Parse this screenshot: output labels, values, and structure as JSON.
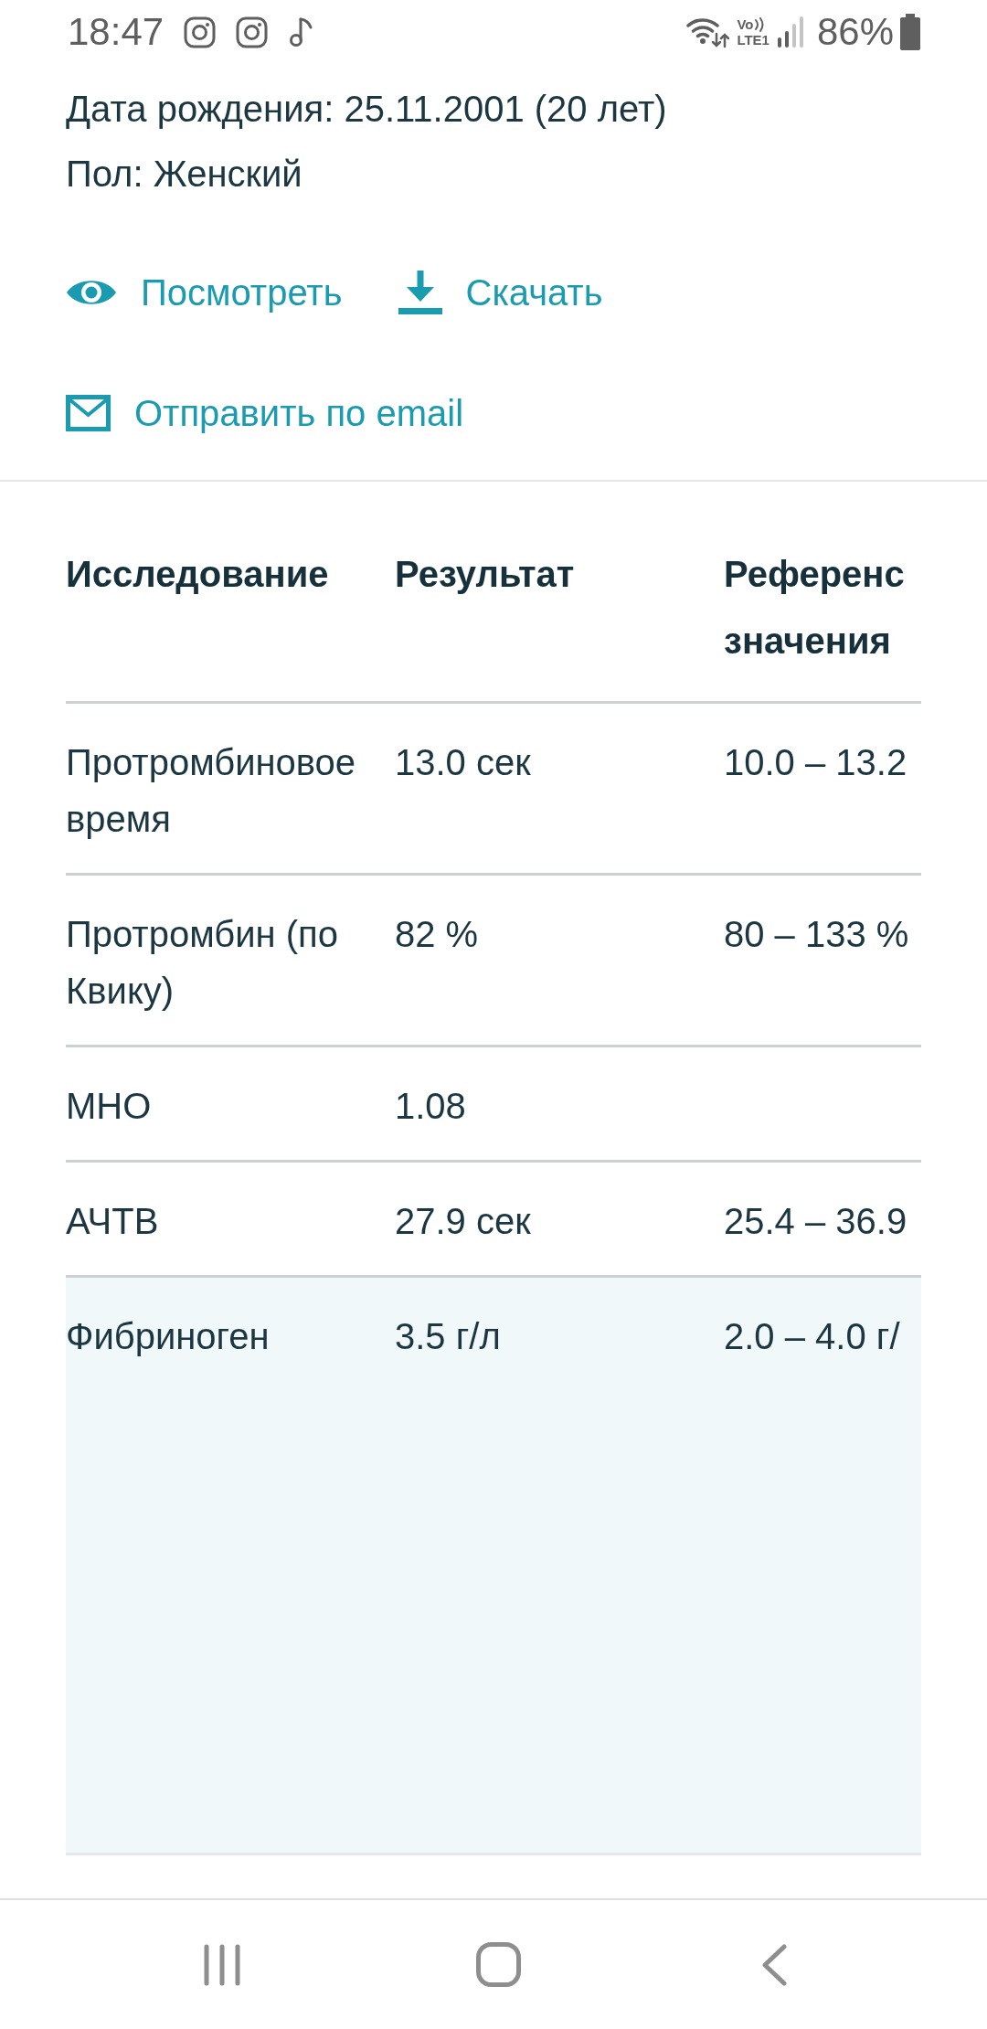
{
  "status_bar": {
    "time": "18:47",
    "volte": "Vo",
    "network": "LTE1",
    "battery": "86%"
  },
  "patient": {
    "birth_date": "Дата рождения: 25.11.2001 (20 лет)",
    "sex": "Пол: Женский"
  },
  "actions": [
    {
      "kind": "view",
      "label": "Посмотреть"
    },
    {
      "kind": "download",
      "label": "Скачать"
    },
    {
      "kind": "email",
      "label": "Отправить по email"
    }
  ],
  "table": {
    "columns": [
      "Исследование",
      "Результат",
      "Референс значения"
    ],
    "rows": [
      {
        "cells": [
          "Протромбиновое время",
          "13.0 сек",
          "10.0 – 13.2"
        ],
        "highlighted": false
      },
      {
        "cells": [
          "Протромбин (по Квику)",
          "82 %",
          "80 – 133 %"
        ],
        "highlighted": false
      },
      {
        "cells": [
          "МНО",
          "1.08"
        ],
        "highlighted": false
      },
      {
        "cells": [
          "АЧТВ",
          "27.9 сек",
          "25.4 – 36.9"
        ],
        "highlighted": false
      },
      {
        "cells": [
          "Фибриноген",
          "3.5 г/л",
          "2.0 – 4.0 г/"
        ],
        "highlighted": true
      }
    ]
  }
}
